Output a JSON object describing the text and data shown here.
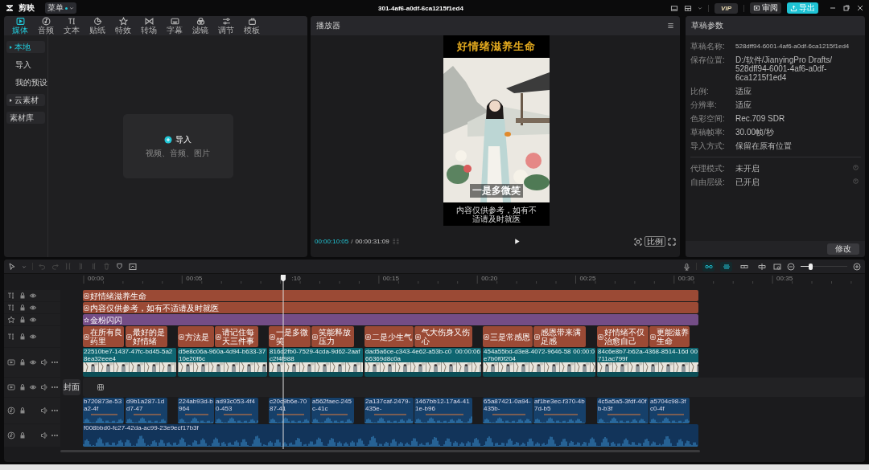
{
  "topbar": {
    "logo": "剪映",
    "menu": "菜单",
    "title": "301-4af6-a0df-6ca1215f1ed4",
    "vip": "VIP",
    "review": "审阅",
    "export": "导出"
  },
  "media": {
    "tabs": [
      {
        "label": "媒体",
        "selected": true
      },
      {
        "label": "音频",
        "selected": false
      },
      {
        "label": "文本",
        "selected": false
      },
      {
        "label": "贴纸",
        "selected": false
      },
      {
        "label": "特效",
        "selected": false
      },
      {
        "label": "转场",
        "selected": false
      },
      {
        "label": "字幕",
        "selected": false
      },
      {
        "label": "滤镜",
        "selected": false
      },
      {
        "label": "调节",
        "selected": false
      },
      {
        "label": "模板",
        "selected": false
      }
    ],
    "sidebar": [
      {
        "label": "本地",
        "kind": "folder",
        "selected": true
      },
      {
        "label": "导入",
        "kind": "link",
        "selected": false
      },
      {
        "label": "我的预设",
        "kind": "link",
        "selected": false
      },
      {
        "label": "云素材",
        "kind": "folder",
        "selected": false
      },
      {
        "label": "素材库",
        "kind": "button",
        "selected": false
      }
    ],
    "import": {
      "label": "导入",
      "hint": "视频、音频、图片"
    }
  },
  "player": {
    "title": "播放器",
    "video": {
      "heading": "好情绪滋养生命",
      "subtitle": "一是多微笑",
      "notice": "内容仅供参考，如有不适请及时就医"
    },
    "current_time": "00:00:10:05",
    "time_separator": "/",
    "total_time": "00:00:31:09",
    "ratio_button": "比例"
  },
  "draft": {
    "title": "草稿参数",
    "info": [
      {
        "label": "草稿名称:",
        "value": "528dff94-6001-4af6-a0df-6ca1215f1ed4"
      },
      {
        "label": "保存位置:",
        "value": "D:/软件/JianyingPro Drafts/\n528dff94-6001-4af6-a0df-6ca1215f1ed4"
      },
      {
        "label": "比例:",
        "value": "适应"
      },
      {
        "label": "分辨率:",
        "value": "适应"
      },
      {
        "label": "色彩空间:",
        "value": "Rec.709 SDR"
      },
      {
        "label": "草稿帧率:",
        "value": "30.00帧/秒"
      },
      {
        "label": "导入方式:",
        "value": "保留在原有位置"
      }
    ],
    "modes": [
      {
        "label": "代理模式:",
        "value": "未开启"
      },
      {
        "label": "自由层级:",
        "value": "已开启"
      }
    ],
    "edit_button": "修改"
  },
  "timeline": {
    "toggles": [
      {
        "on": true
      },
      {
        "on": true
      },
      {
        "on": false
      },
      {
        "on": false
      }
    ],
    "zoom": {
      "level": 0.2
    },
    "ruler": [
      "00:00",
      "00:05",
      ":10",
      "00:15",
      "00:20",
      "00:25",
      "00:30",
      "00:35"
    ],
    "tracks": [
      {
        "kind": "text",
        "clips": [
          {
            "label": "好情绪滋养生命"
          }
        ]
      },
      {
        "kind": "text",
        "clips": [
          {
            "label": "内容仅供参考，如有不适请及时就医"
          }
        ]
      },
      {
        "kind": "effect",
        "clips": [
          {
            "label": "金粉闪闪"
          }
        ]
      },
      {
        "kind": "text",
        "clips": [
          {
            "label": "在所有良药里"
          },
          {
            "label": "最好的是好情绪"
          },
          {
            "label": "方法是"
          },
          {
            "label": "请记住每天三件事"
          },
          {
            "label": "一是多微笑"
          },
          {
            "label": "笑能释放压力"
          },
          {
            "label": "二是少生气"
          },
          {
            "label": "气大伤身又伤心"
          },
          {
            "label": "三是常感恩"
          },
          {
            "label": "感恩带来满足感"
          },
          {
            "label": "好情绪不仅治愈自己"
          },
          {
            "label": "更能滋养生命"
          }
        ]
      },
      {
        "kind": "video",
        "clips": [
          {
            "label": "22510be7-1437-47fc-bd45-5a28ea32eee4"
          },
          {
            "label": "d5e8c06a-960a-4d94-b633-3710e20f6c"
          },
          {
            "label": "816d2fb0-7529-4cda-9d62-2aafc2f4f988"
          },
          {
            "label": "dad5a6ce-c343-4e62-a53b-c066369d8c0a",
            "duration": "00:00:06"
          },
          {
            "label": "454a55bd-d3e8-4072-9646-58e7b0f0f204",
            "duration": "00:00:0"
          },
          {
            "label": "84c6e8b7-b62a-4368-8514-16d711ac799f",
            "duration": "00"
          }
        ]
      },
      {
        "kind": "cover",
        "button": "封面"
      },
      {
        "kind": "audio",
        "clips": [
          {
            "label": "b720873e-53a2-4f"
          },
          {
            "label": "d9b1a287-1dd7-47"
          },
          {
            "label": "224ab93d-b964"
          },
          {
            "label": "ad93c053-4f40-453"
          },
          {
            "label": "c20c9b6e-7087-41"
          },
          {
            "label": "a562faec-245c-41c"
          },
          {
            "label": "2a137caf-2479-435e-"
          },
          {
            "label": "1467bb12-17a4-411e-b96"
          },
          {
            "label": "65a87421-0a94-435b-"
          },
          {
            "label": "af1be3ec-f370-4b7d-b5"
          },
          {
            "label": "4c5a5a5-3fdf-40fb-b3f"
          },
          {
            "label": "a5704c98-3fc0-4f"
          }
        ]
      },
      {
        "kind": "audio",
        "clips": [
          {
            "label": "f008bbd0-fc27-42da-ac99-23e9ecf17b3f"
          }
        ]
      }
    ]
  }
}
